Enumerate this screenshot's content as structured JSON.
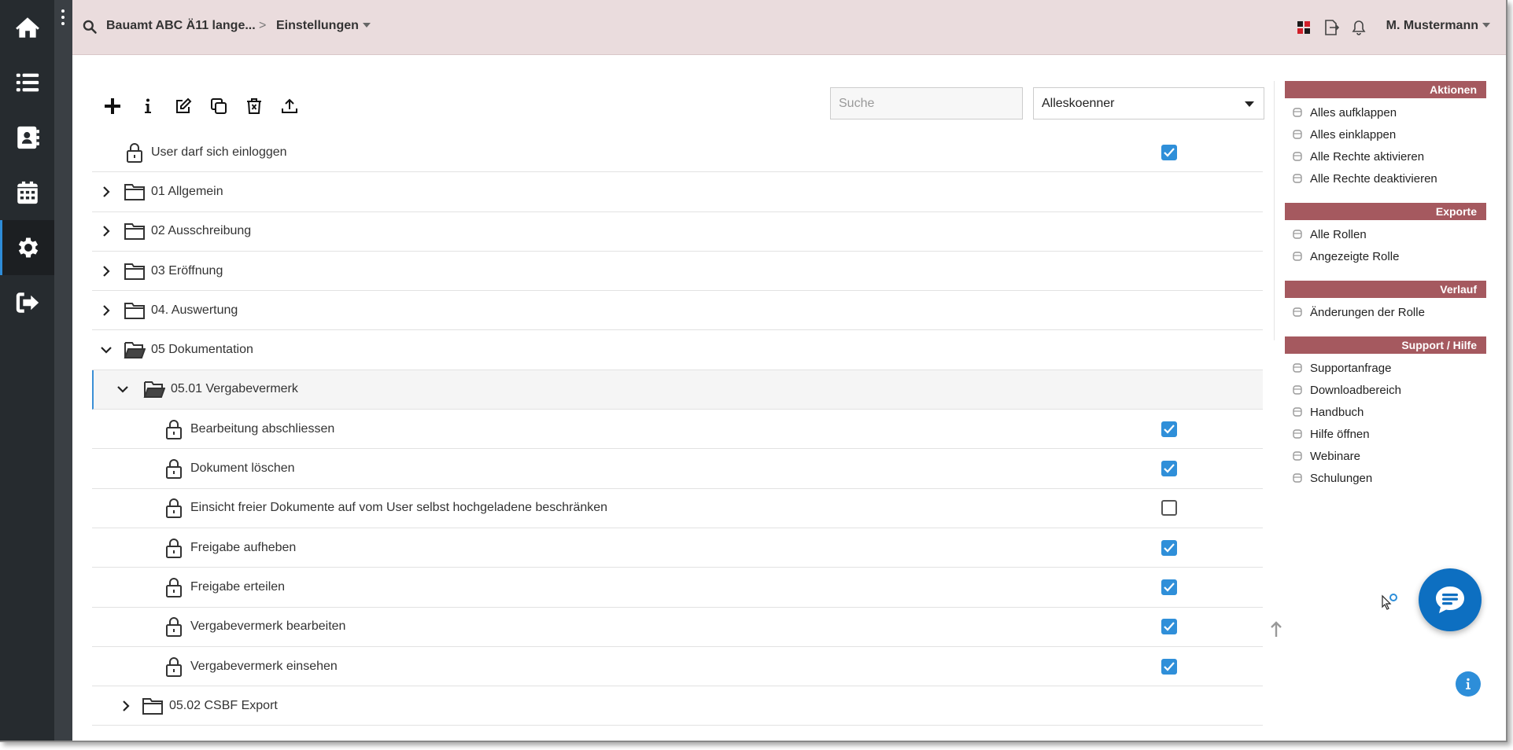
{
  "header": {
    "breadcrumb_project": "Bauamt ABC Ä11 lange...",
    "breadcrumb_sep": ">",
    "breadcrumb_current": "Einstellungen",
    "user_name": "M. Mustermann"
  },
  "rail": {
    "items": [
      "home-icon",
      "list-icon",
      "contacts-icon",
      "calendar-icon",
      "settings-icon",
      "logout-icon"
    ],
    "active_index": 4
  },
  "toolbar": {
    "search_placeholder": "Suche",
    "role_selected": "Alleskoenner"
  },
  "tree": [
    {
      "label": "User darf sich einloggen",
      "type": "permission",
      "checked": true
    },
    {
      "label": "01 Allgemein",
      "type": "folder",
      "expanded": false
    },
    {
      "label": "02 Ausschreibung",
      "type": "folder",
      "expanded": false
    },
    {
      "label": "03 Eröffnung",
      "type": "folder",
      "expanded": false
    },
    {
      "label": "04. Auswertung",
      "type": "folder",
      "expanded": false
    },
    {
      "label": "05 Dokumentation",
      "type": "folder",
      "expanded": true
    },
    {
      "label": "05.01 Vergabevermerk",
      "type": "folder",
      "expanded": true
    },
    {
      "label": "Bearbeitung abschliessen",
      "type": "permission",
      "checked": true
    },
    {
      "label": "Dokument löschen",
      "type": "permission",
      "checked": true
    },
    {
      "label": "Einsicht freier Dokumente auf vom User selbst hochgeladene beschränken",
      "type": "permission",
      "checked": false
    },
    {
      "label": "Freigabe aufheben",
      "type": "permission",
      "checked": true
    },
    {
      "label": "Freigabe erteilen",
      "type": "permission",
      "checked": true
    },
    {
      "label": "Vergabevermerk bearbeiten",
      "type": "permission",
      "checked": true
    },
    {
      "label": "Vergabevermerk einsehen",
      "type": "permission",
      "checked": true
    },
    {
      "label": "05.02 CSBF Export",
      "type": "folder",
      "expanded": false
    }
  ],
  "sidebar": {
    "panels": [
      {
        "title": "Aktionen",
        "items": [
          "Alles aufklappen",
          "Alles einklappen",
          "Alle Rechte aktivieren",
          "Alle Rechte deaktivieren"
        ]
      },
      {
        "title": "Exporte",
        "items": [
          "Alle Rollen",
          "Angezeigte Rolle"
        ]
      },
      {
        "title": "Verlauf",
        "items": [
          "Änderungen der Rolle"
        ]
      },
      {
        "title": "Support / Hilfe",
        "items": [
          "Supportanfrage",
          "Downloadbereich",
          "Handbuch",
          "Hilfe öffnen",
          "Webinare",
          "Schulungen"
        ]
      }
    ]
  },
  "colors": {
    "rail_bg": "#262b2f",
    "header_bg": "#eadcdd",
    "panel_head": "#a5595f",
    "checkbox_on": "#2f8fd9",
    "fab": "#0d6fc1"
  }
}
